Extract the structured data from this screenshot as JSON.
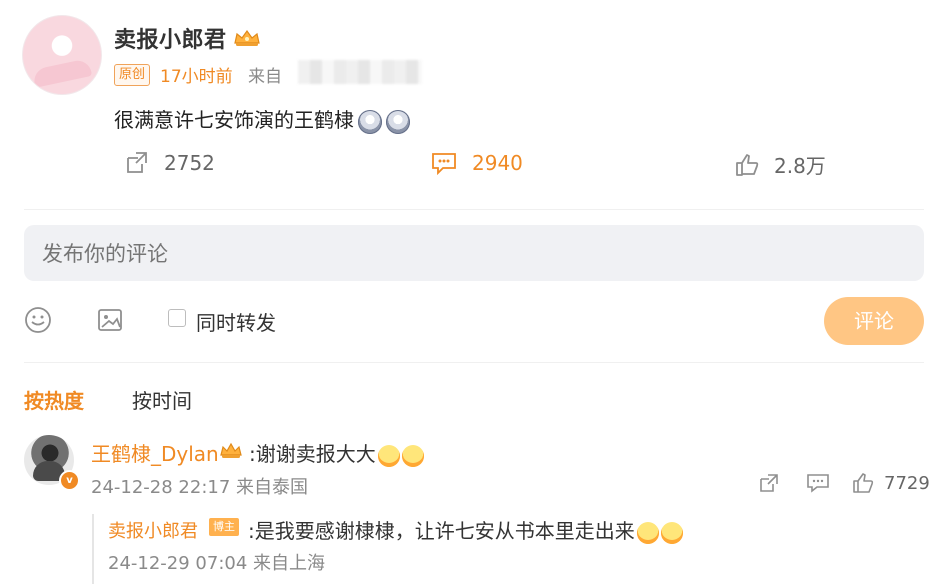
{
  "post": {
    "author": "卖报小郎君",
    "origin_badge": "原创",
    "time": "17小时前",
    "source_prefix": "来自",
    "text": "很满意许七安饰演的王鹤棣",
    "repost_count": "2752",
    "comment_count": "2940",
    "like_count": "2.8万"
  },
  "composer": {
    "placeholder": "发布你的评论",
    "repost_label": "同时转发",
    "submit_label": "评论"
  },
  "sort": {
    "hot": "按热度",
    "time": "按时间"
  },
  "comment": {
    "user": "王鹤棣_Dylan",
    "text": ":谢谢卖报大大",
    "meta": "24-12-28 22:17 来自泰国",
    "like_count": "7729"
  },
  "reply": {
    "user": "卖报小郎君",
    "badge": "博主",
    "text": ":是我要感谢棣棣，让许七安从书本里走出来",
    "meta": "24-12-29 07:04 来自上海"
  },
  "colors": {
    "accent": "#f08a24",
    "button_disabled": "#ffc684",
    "muted": "#8a8a8a"
  },
  "icons": {
    "repost": "share-arrow-icon",
    "comment": "comment-icon",
    "like": "thumbs-up-icon",
    "emoji": "smile-icon",
    "image": "image-icon",
    "crown": "crown-icon",
    "verify": "verified-badge-icon"
  }
}
